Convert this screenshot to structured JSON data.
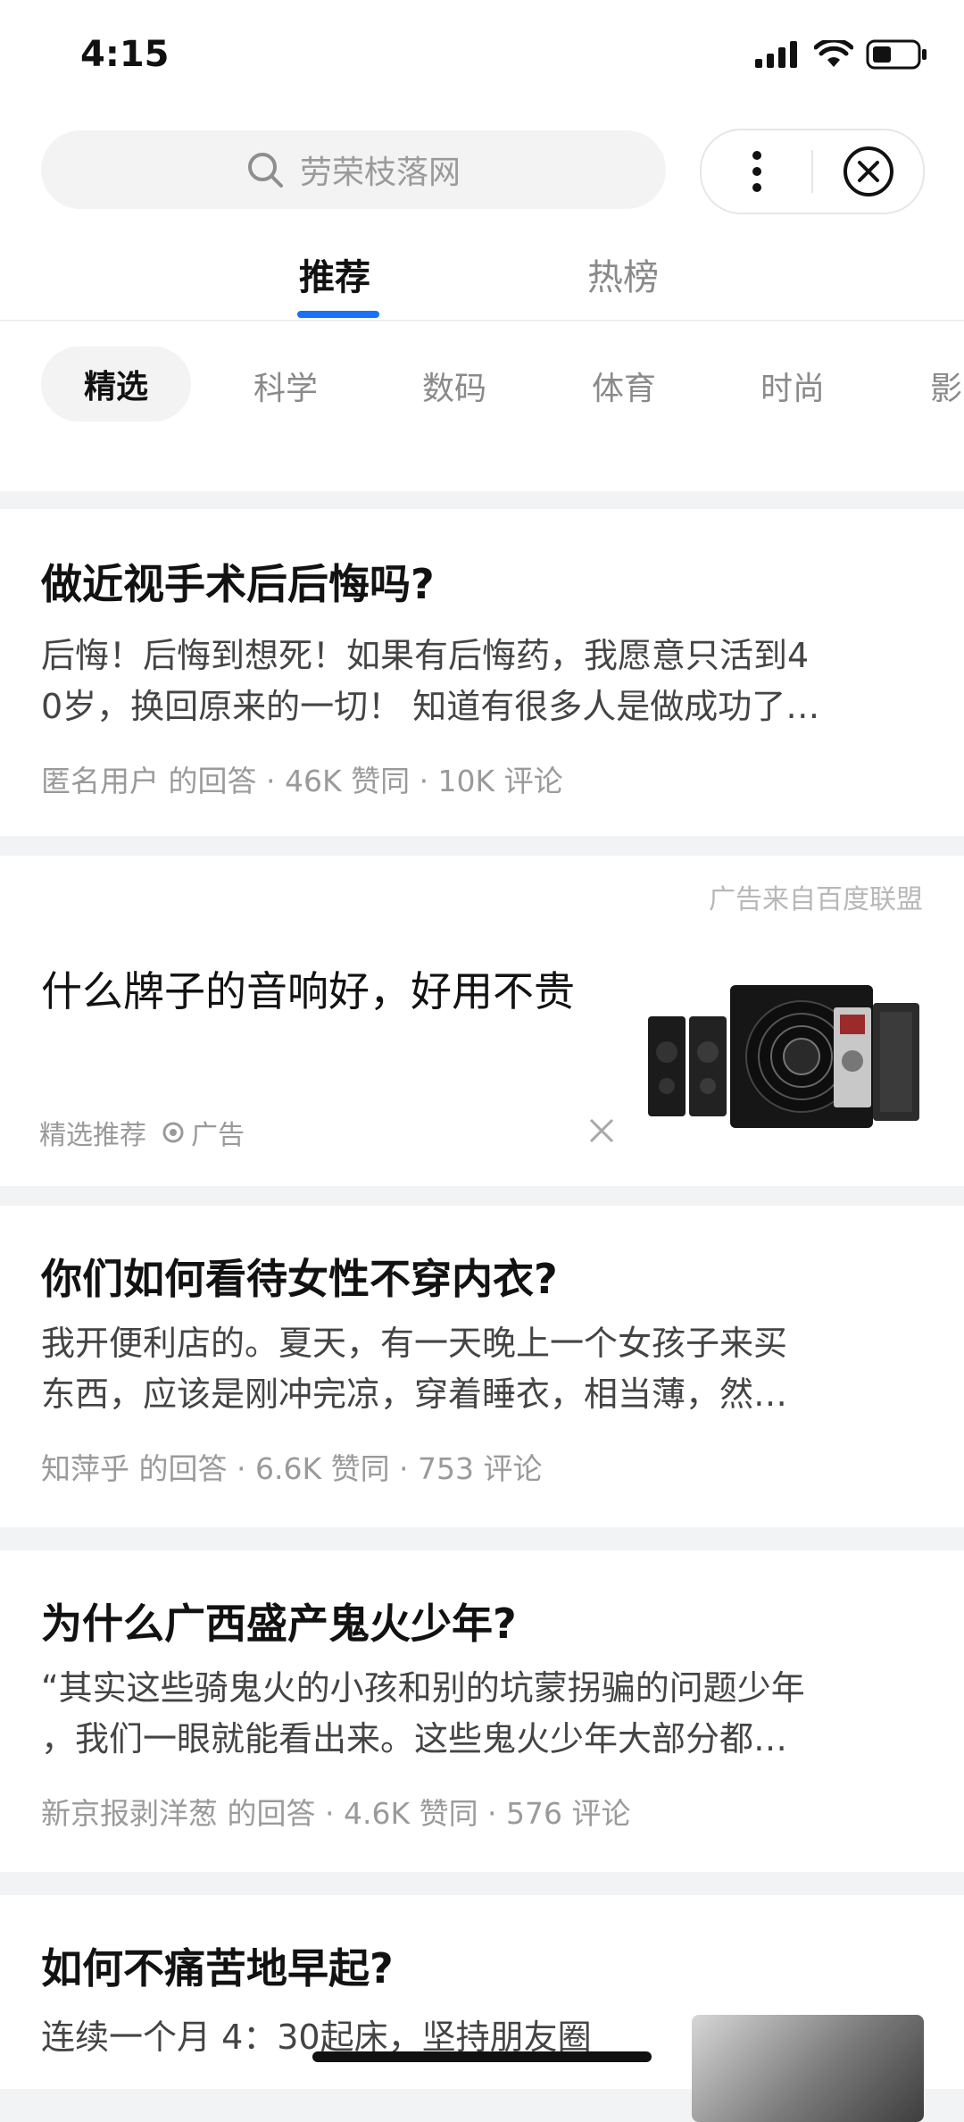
{
  "status": {
    "time": "4:15"
  },
  "search": {
    "placeholder": "劳荣枝落网"
  },
  "tabs": [
    "推荐",
    "热榜"
  ],
  "categories": [
    "精选",
    "科学",
    "数码",
    "体育",
    "时尚",
    "影"
  ],
  "feed": [
    {
      "question": "做近视手术后后悔吗?",
      "excerpt_line1": "后悔！后悔到想死！如果有后悔药，我愿意只活到4",
      "excerpt_line2": "0岁，换回原来的一切！ 知道有很多人是做成功了…",
      "meta": "匿名用户 的回答 · 46K 赞同 · 10K 评论"
    },
    {
      "question": "你们如何看待女性不穿内衣?",
      "excerpt_line1": "我开便利店的。夏天，有一天晚上一个女孩子来买",
      "excerpt_line2": "东西，应该是刚冲完凉，穿着睡衣，相当薄，然…",
      "meta": "知萍乎 的回答 · 6.6K 赞同 · 753 评论"
    },
    {
      "question": "为什么广西盛产鬼火少年?",
      "excerpt_line1": "“其实这些骑鬼火的小孩和别的坑蒙拐骗的问题少年",
      "excerpt_line2": "，我们一眼就能看出来。这些鬼火少年大部分都…",
      "meta": "新京报剥洋葱 的回答 · 4.6K 赞同 · 576 评论"
    },
    {
      "question": "如何不痛苦地早起?",
      "excerpt_line1": "连续一个月 4：30起床，坚持朋友圈"
    }
  ],
  "ad": {
    "source": "广告来自百度联盟",
    "title": "什么牌子的音响好，好用不贵",
    "tag": "精选推荐",
    "label": "广告"
  }
}
